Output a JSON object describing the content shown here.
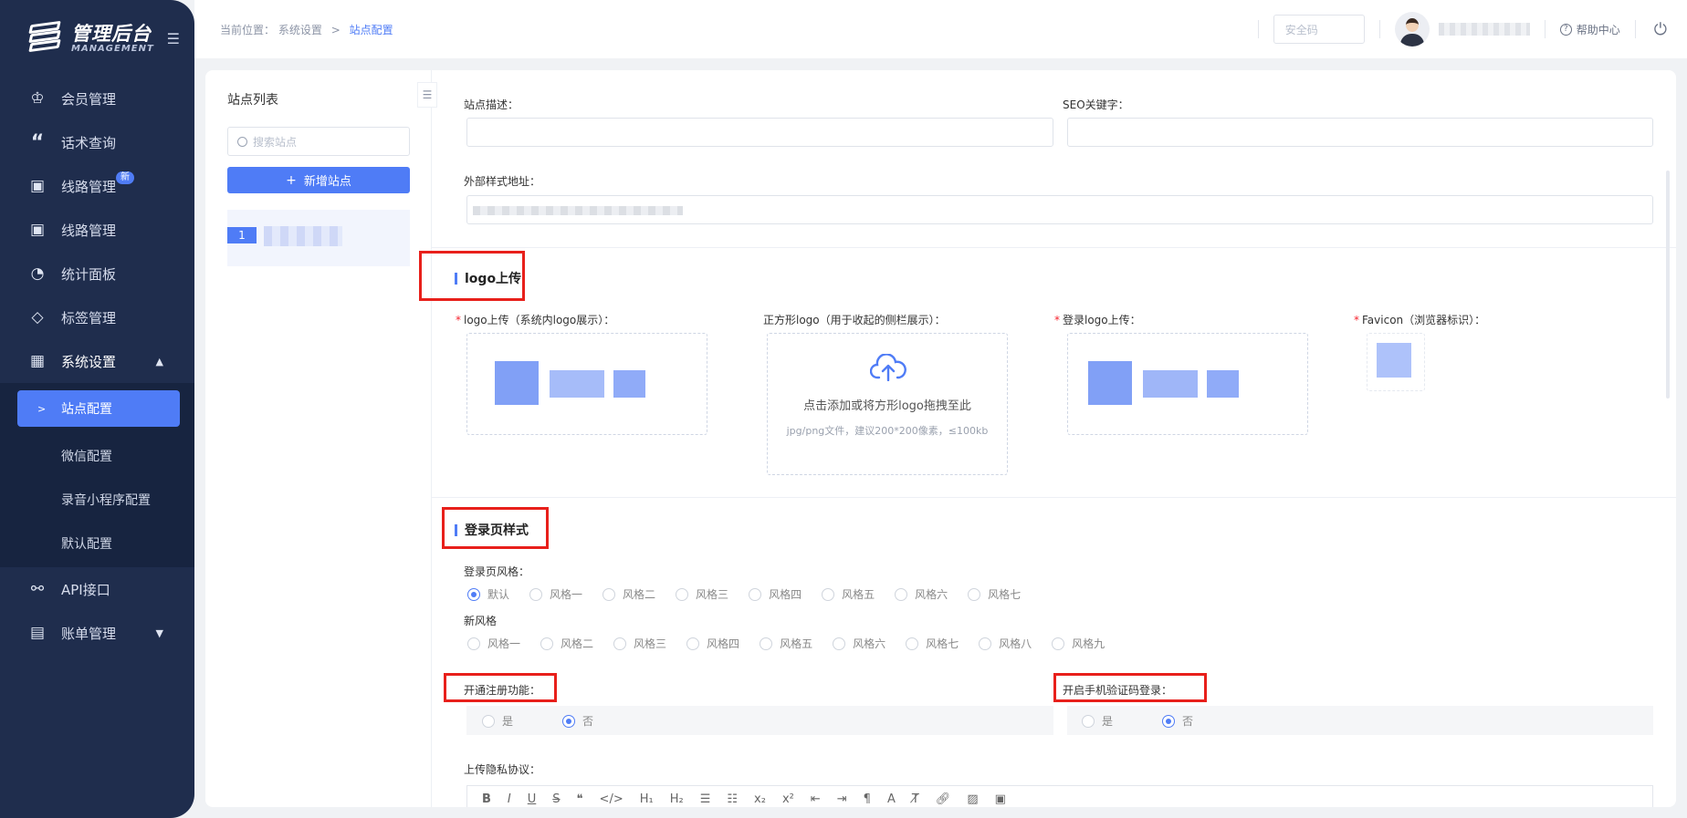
{
  "sidebar": {
    "logo_title": "管理后台",
    "logo_sub": "MANAGEMENT",
    "menu": [
      {
        "label": "会员管理",
        "icon": "crown-icon"
      },
      {
        "label": "话术查询",
        "icon": "quote-icon"
      },
      {
        "label": "线路管理",
        "icon": "line-chart-icon",
        "badge": "新"
      },
      {
        "label": "线路管理",
        "icon": "line-chart-icon"
      },
      {
        "label": "统计面板",
        "icon": "pie-chart-icon"
      },
      {
        "label": "标签管理",
        "icon": "tag-icon"
      },
      {
        "label": "系统设置",
        "icon": "grid-icon"
      }
    ],
    "submenu": [
      "站点配置",
      "微信配置",
      "录音小程序配置",
      "默认配置"
    ],
    "menu_after": [
      {
        "label": "API接口",
        "icon": "link-icon"
      },
      {
        "label": "账单管理",
        "icon": "bill-icon"
      }
    ]
  },
  "topbar": {
    "crumb_prefix": "当前位置：",
    "crumb_parent": "系统设置",
    "crumb_sep": ">",
    "crumb_current": "站点配置",
    "security_placeholder": "安全码",
    "help": "帮助中心"
  },
  "site_panel": {
    "title": "站点列表",
    "search_placeholder": "搜索站点",
    "add_button": "新增站点",
    "row_index": "1"
  },
  "form": {
    "site_desc_label": "站点描述：",
    "seo_label": "SEO关键字：",
    "ext_style_label": "外部样式地址：",
    "logo_section": "logo上传",
    "logo_label": "logo上传（系统内logo展示）：",
    "square_logo_label": "正方形logo（用于收起的侧栏展示）：",
    "square_upload_text": "点击添加或将方形logo拖拽至此",
    "square_upload_hint": "jpg/png文件，建议200*200像素，≤100kb",
    "login_logo_label": "登录logo上传：",
    "favicon_label": "Favicon（浏览器标识）：",
    "login_section": "登录页样式",
    "login_style_label": "登录页风格：",
    "login_styles": [
      "默认",
      "风格一",
      "风格二",
      "风格三",
      "风格四",
      "风格五",
      "风格六",
      "风格七"
    ],
    "new_style_label": "新风格",
    "new_styles": [
      "风格一",
      "风格二",
      "风格三",
      "风格四",
      "风格五",
      "风格六",
      "风格七",
      "风格八",
      "风格九"
    ],
    "register_label": "开通注册功能：",
    "sms_login_label": "开启手机验证码登录：",
    "yes": "是",
    "no": "否",
    "privacy_label": "上传隐私协议："
  },
  "colors": {
    "accent": "#4f7cf6",
    "sidebar_bg": "#1f2d4d",
    "highlight_red": "#e8201b"
  }
}
